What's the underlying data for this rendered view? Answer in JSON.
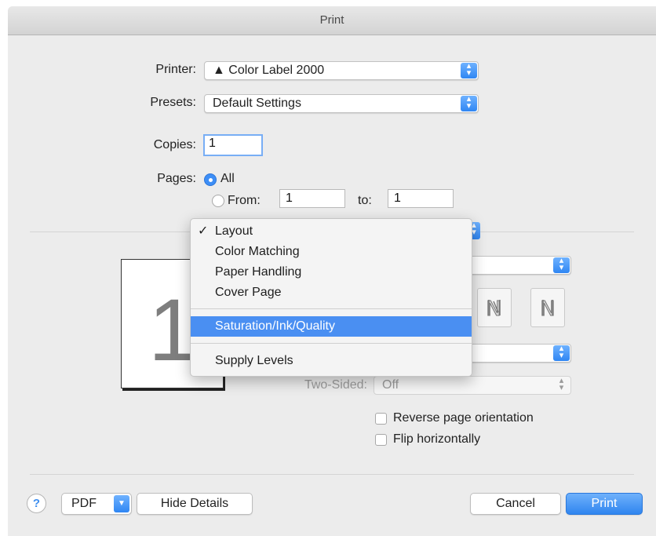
{
  "window": {
    "title": "Print"
  },
  "printer": {
    "label": "Printer:",
    "value": "▲ Color Label 2000"
  },
  "presets": {
    "label": "Presets:",
    "value": "Default Settings"
  },
  "copies": {
    "label": "Copies:",
    "value": "1"
  },
  "pages": {
    "label": "Pages:",
    "all_label": "All",
    "from_label": "From:",
    "from_value": "1",
    "to_label": "to:",
    "to_value": "1",
    "selected": "All"
  },
  "section_menu": {
    "items": [
      {
        "label": "Layout",
        "checked": true
      },
      {
        "label": "Color Matching"
      },
      {
        "label": "Paper Handling"
      },
      {
        "label": "Cover Page"
      },
      {
        "label": "Saturation/Ink/Quality",
        "highlighted": true
      },
      {
        "label": "Supply Levels"
      }
    ],
    "checkmark": "✓"
  },
  "preview": {
    "page_number": "1"
  },
  "two_sided": {
    "label": "Two-Sided:",
    "value": "Off"
  },
  "options": {
    "reverse_orientation": "Reverse page orientation",
    "flip_horizontally": "Flip horizontally"
  },
  "footer": {
    "help": "?",
    "pdf": "PDF",
    "hide_details": "Hide Details",
    "cancel": "Cancel",
    "print": "Print"
  },
  "colors": {
    "accent": "#3d8ef6",
    "menu_highlight": "#4a8ff2"
  }
}
